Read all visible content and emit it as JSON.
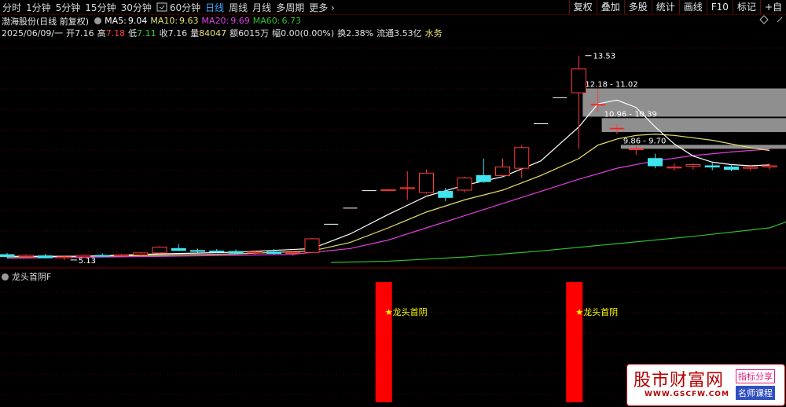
{
  "toolbar": {
    "periods": [
      {
        "label": "分时",
        "active": false
      },
      {
        "label": "1分钟",
        "active": false
      },
      {
        "label": "5分钟",
        "active": false
      },
      {
        "label": "15分钟",
        "active": false
      },
      {
        "label": "30分钟",
        "active": false
      },
      {
        "label": "60分钟",
        "active": false
      },
      {
        "label": "日线",
        "active": true
      },
      {
        "label": "周线",
        "active": false
      },
      {
        "label": "月线",
        "active": false
      },
      {
        "label": "多周期",
        "active": false
      }
    ],
    "more_label": "更多",
    "right_buttons": [
      "复权",
      "叠加",
      "多股",
      "统计",
      "画线",
      "F10",
      "标记",
      "+自"
    ]
  },
  "stock": {
    "name": "渤海股份",
    "mode": "(日线 前复权)",
    "ma5_label": "MA5:",
    "ma5_value": "9.04",
    "ma10_label": "MA10:",
    "ma10_value": "9.63",
    "ma20_label": "MA20:",
    "ma20_value": "9.69",
    "ma60_label": "MA60:",
    "ma60_value": "6.73"
  },
  "quote": {
    "date": "2025/06/09/一",
    "open_label": "开",
    "open_value": "7.16",
    "high_label": "高",
    "high_value": "7.18",
    "low_label": "低",
    "low_value": "7.11",
    "close_label": "收",
    "close_value": "7.16",
    "vol_label": "量",
    "vol_value": "84047",
    "amt_label": "额",
    "amt_value": "6015万",
    "chg_label": "幅",
    "chg_value": "0.00(0.00%)",
    "turn_label": "换",
    "turn_value": "2.38%",
    "float_label": "流通",
    "float_value": "3.53亿",
    "water_label": "水务"
  },
  "indicator": {
    "name": "龙头首阴F",
    "signal_label": "★龙头首阴"
  },
  "colors": {
    "up": "#ff3b3b",
    "down": "#3fe6f0",
    "ma5": "#ffffff",
    "ma10": "#e8e070",
    "ma20": "#e040e0",
    "ma60": "#30c030",
    "zone": "#a8a8a8",
    "signal": "#ff0000",
    "signal_text": "#ffff00"
  },
  "chart_data": {
    "type": "candlestick",
    "candles": [
      {
        "o": 5.35,
        "h": 5.42,
        "l": 5.22,
        "c": 5.27
      },
      {
        "o": 5.27,
        "h": 5.36,
        "l": 5.2,
        "c": 5.32
      },
      {
        "o": 5.3,
        "h": 5.38,
        "l": 5.2,
        "c": 5.22
      },
      {
        "o": 5.22,
        "h": 5.3,
        "l": 5.13,
        "c": 5.26
      },
      {
        "o": 5.26,
        "h": 5.35,
        "l": 5.22,
        "c": 5.32
      },
      {
        "o": 5.32,
        "h": 5.4,
        "l": 5.25,
        "c": 5.3
      },
      {
        "o": 5.3,
        "h": 5.38,
        "l": 5.24,
        "c": 5.34
      },
      {
        "o": 5.34,
        "h": 5.45,
        "l": 5.3,
        "c": 5.42
      },
      {
        "o": 5.42,
        "h": 5.7,
        "l": 5.38,
        "c": 5.66
      },
      {
        "o": 5.6,
        "h": 5.78,
        "l": 5.5,
        "c": 5.52
      },
      {
        "o": 5.52,
        "h": 5.6,
        "l": 5.42,
        "c": 5.5
      },
      {
        "o": 5.5,
        "h": 5.58,
        "l": 5.42,
        "c": 5.48
      },
      {
        "o": 5.48,
        "h": 5.56,
        "l": 5.38,
        "c": 5.42
      },
      {
        "o": 5.42,
        "h": 5.52,
        "l": 5.34,
        "c": 5.46
      },
      {
        "o": 5.46,
        "h": 5.58,
        "l": 5.36,
        "c": 5.4
      },
      {
        "o": 5.4,
        "h": 5.5,
        "l": 5.3,
        "c": 5.44
      },
      {
        "o": 5.44,
        "h": 6.03,
        "l": 5.42,
        "c": 6.0
      },
      {
        "o": 6.6,
        "h": 6.6,
        "l": 6.6,
        "c": 6.6
      },
      {
        "o": 7.26,
        "h": 7.26,
        "l": 7.26,
        "c": 7.26
      },
      {
        "o": 7.98,
        "h": 7.98,
        "l": 7.98,
        "c": 7.98
      },
      {
        "o": 8.0,
        "h": 8.05,
        "l": 7.95,
        "c": 8.02
      },
      {
        "o": 8.1,
        "h": 8.78,
        "l": 7.6,
        "c": 8.1
      },
      {
        "o": 7.9,
        "h": 8.85,
        "l": 7.85,
        "c": 8.7
      },
      {
        "o": 7.95,
        "h": 8.1,
        "l": 7.55,
        "c": 7.7
      },
      {
        "o": 8.0,
        "h": 8.55,
        "l": 7.9,
        "c": 8.5
      },
      {
        "o": 8.6,
        "h": 9.3,
        "l": 8.3,
        "c": 8.35
      },
      {
        "o": 8.6,
        "h": 9.3,
        "l": 8.6,
        "c": 8.95
      },
      {
        "o": 8.9,
        "h": 9.85,
        "l": 8.5,
        "c": 9.75
      },
      {
        "o": 10.73,
        "h": 10.73,
        "l": 10.73,
        "c": 10.73
      },
      {
        "o": 11.8,
        "h": 11.8,
        "l": 11.8,
        "c": 11.8
      },
      {
        "o": 12.0,
        "h": 13.53,
        "l": 9.7,
        "c": 12.98
      },
      {
        "o": 11.53,
        "h": 12.18,
        "l": 11.2,
        "c": 11.53
      },
      {
        "o": 10.55,
        "h": 10.7,
        "l": 10.3,
        "c": 10.55
      },
      {
        "o": 9.7,
        "h": 9.86,
        "l": 9.45,
        "c": 9.7
      },
      {
        "o": 9.3,
        "h": 9.5,
        "l": 8.9,
        "c": 9.0
      },
      {
        "o": 8.92,
        "h": 9.1,
        "l": 8.8,
        "c": 8.95
      },
      {
        "o": 8.98,
        "h": 9.1,
        "l": 8.85,
        "c": 9.05
      },
      {
        "o": 9.0,
        "h": 9.15,
        "l": 8.82,
        "c": 8.95
      },
      {
        "o": 8.95,
        "h": 9.05,
        "l": 8.78,
        "c": 8.85
      },
      {
        "o": 8.9,
        "h": 9.05,
        "l": 8.8,
        "c": 8.95
      },
      {
        "o": 8.95,
        "h": 9.1,
        "l": 8.85,
        "c": 9.0
      }
    ],
    "ma5": [
      [
        0,
        5.28
      ],
      [
        4,
        5.28
      ],
      [
        8,
        5.38
      ],
      [
        12,
        5.45
      ],
      [
        16,
        5.6
      ],
      [
        18,
        6.2
      ],
      [
        20,
        7.0
      ],
      [
        22,
        7.75
      ],
      [
        24,
        8.2
      ],
      [
        26,
        8.55
      ],
      [
        28,
        9.2
      ],
      [
        30,
        10.6
      ],
      [
        31,
        11.55
      ],
      [
        32,
        11.7
      ],
      [
        33,
        11.4
      ],
      [
        34,
        10.6
      ],
      [
        35,
        9.9
      ],
      [
        36,
        9.4
      ],
      [
        37,
        9.15
      ],
      [
        38,
        9.05
      ],
      [
        39,
        9.0
      ],
      [
        40,
        9.04
      ]
    ],
    "ma10": [
      [
        0,
        5.25
      ],
      [
        6,
        5.3
      ],
      [
        12,
        5.38
      ],
      [
        16,
        5.5
      ],
      [
        18,
        5.85
      ],
      [
        20,
        6.45
      ],
      [
        22,
        7.1
      ],
      [
        24,
        7.6
      ],
      [
        26,
        8.0
      ],
      [
        28,
        8.6
      ],
      [
        30,
        9.3
      ],
      [
        31,
        9.85
      ],
      [
        32,
        10.1
      ],
      [
        33,
        10.25
      ],
      [
        34,
        10.3
      ],
      [
        35,
        10.25
      ],
      [
        36,
        10.15
      ],
      [
        37,
        10.05
      ],
      [
        38,
        9.9
      ],
      [
        39,
        9.75
      ],
      [
        40,
        9.63
      ]
    ],
    "ma20": [
      [
        0,
        5.2
      ],
      [
        8,
        5.28
      ],
      [
        12,
        5.32
      ],
      [
        15,
        5.36
      ],
      [
        18,
        5.6
      ],
      [
        20,
        5.95
      ],
      [
        22,
        6.45
      ],
      [
        24,
        6.95
      ],
      [
        26,
        7.45
      ],
      [
        28,
        7.95
      ],
      [
        30,
        8.45
      ],
      [
        32,
        8.9
      ],
      [
        34,
        9.2
      ],
      [
        36,
        9.42
      ],
      [
        38,
        9.57
      ],
      [
        40,
        9.69
      ]
    ],
    "ma60": [
      [
        17,
        5.03
      ],
      [
        20,
        5.08
      ],
      [
        24,
        5.25
      ],
      [
        28,
        5.5
      ],
      [
        32,
        5.8
      ],
      [
        36,
        6.1
      ],
      [
        40,
        6.45
      ],
      [
        41,
        6.73
      ]
    ],
    "zones": [
      {
        "label": "12.18 - 11.02",
        "top": 12.18,
        "bottom": 11.02,
        "from": 30.2
      },
      {
        "label": "10.96 - 10.39",
        "top": 10.96,
        "bottom": 10.39,
        "from": 31.2
      },
      {
        "label": "9.86 - 9.70",
        "top": 9.86,
        "bottom": 9.7,
        "from": 32.2
      }
    ],
    "annotations": [
      {
        "label": "13.53",
        "index": 30,
        "value": 13.53
      },
      {
        "label": "5.13",
        "index": 3,
        "value": 5.13
      }
    ],
    "signals": [
      19,
      29
    ],
    "ylim": [
      4.9,
      14.2
    ]
  }
}
